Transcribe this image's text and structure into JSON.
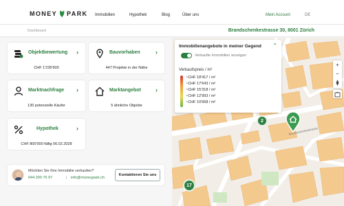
{
  "nav": {
    "logo_left": "MONEY",
    "logo_right": "PARK",
    "links": [
      "Immobilien",
      "Hypothek",
      "Blog",
      "Über uns"
    ],
    "account": "Mein Account",
    "language": "DE"
  },
  "subheader": {
    "breadcrumb": "Dashboard",
    "address": "Brandschenkestrasse 30, 8001 Zürich"
  },
  "cards": [
    {
      "title": "Objektbewertung",
      "value": "CHF 1'235'600",
      "icon": "money-stack-icon"
    },
    {
      "title": "Bauvorhaben",
      "value": "447 Projekte in der Nähe",
      "icon": "location-pin-icon"
    },
    {
      "title": "Marktnachfrage",
      "value": "130 potenzielle Käufer",
      "icon": "person-icon"
    },
    {
      "title": "Marktangebot",
      "value": "5 ähnliche Objekte",
      "icon": "house-icon"
    },
    {
      "title": "Hypothek",
      "value": "CHF 800'000 fällig 06.02.2028",
      "icon": "percent-icon"
    }
  ],
  "contact": {
    "question": "Möchten Sie Ihre Immobilie verkaufen?",
    "phone": "044 200 75 97",
    "separator": "|",
    "email": "info@moneypark.ch",
    "button": "Kontaktieren Sie uns"
  },
  "map_panel": {
    "title": "Immobilienangebote in meiner Gegend",
    "toggle_label": "Verkaufte Immobilien anzeigen",
    "price_label": "Verkaufspreis / m²",
    "legend": [
      "~CHF 18'417 / m²",
      "~CHF 17'643 / m²",
      "~CHF 15'318 / m²",
      "~CHF 12'993 / m²",
      "~CHF 10'668 / m²"
    ]
  },
  "map": {
    "cluster_a": "2",
    "cluster_b": "17",
    "street": "Brandschenkestrasse",
    "zoom_in": "+",
    "zoom_out": "−"
  },
  "colors": {
    "brand_green": "#2b7f3f",
    "map_buildings": "#f4c98d"
  }
}
